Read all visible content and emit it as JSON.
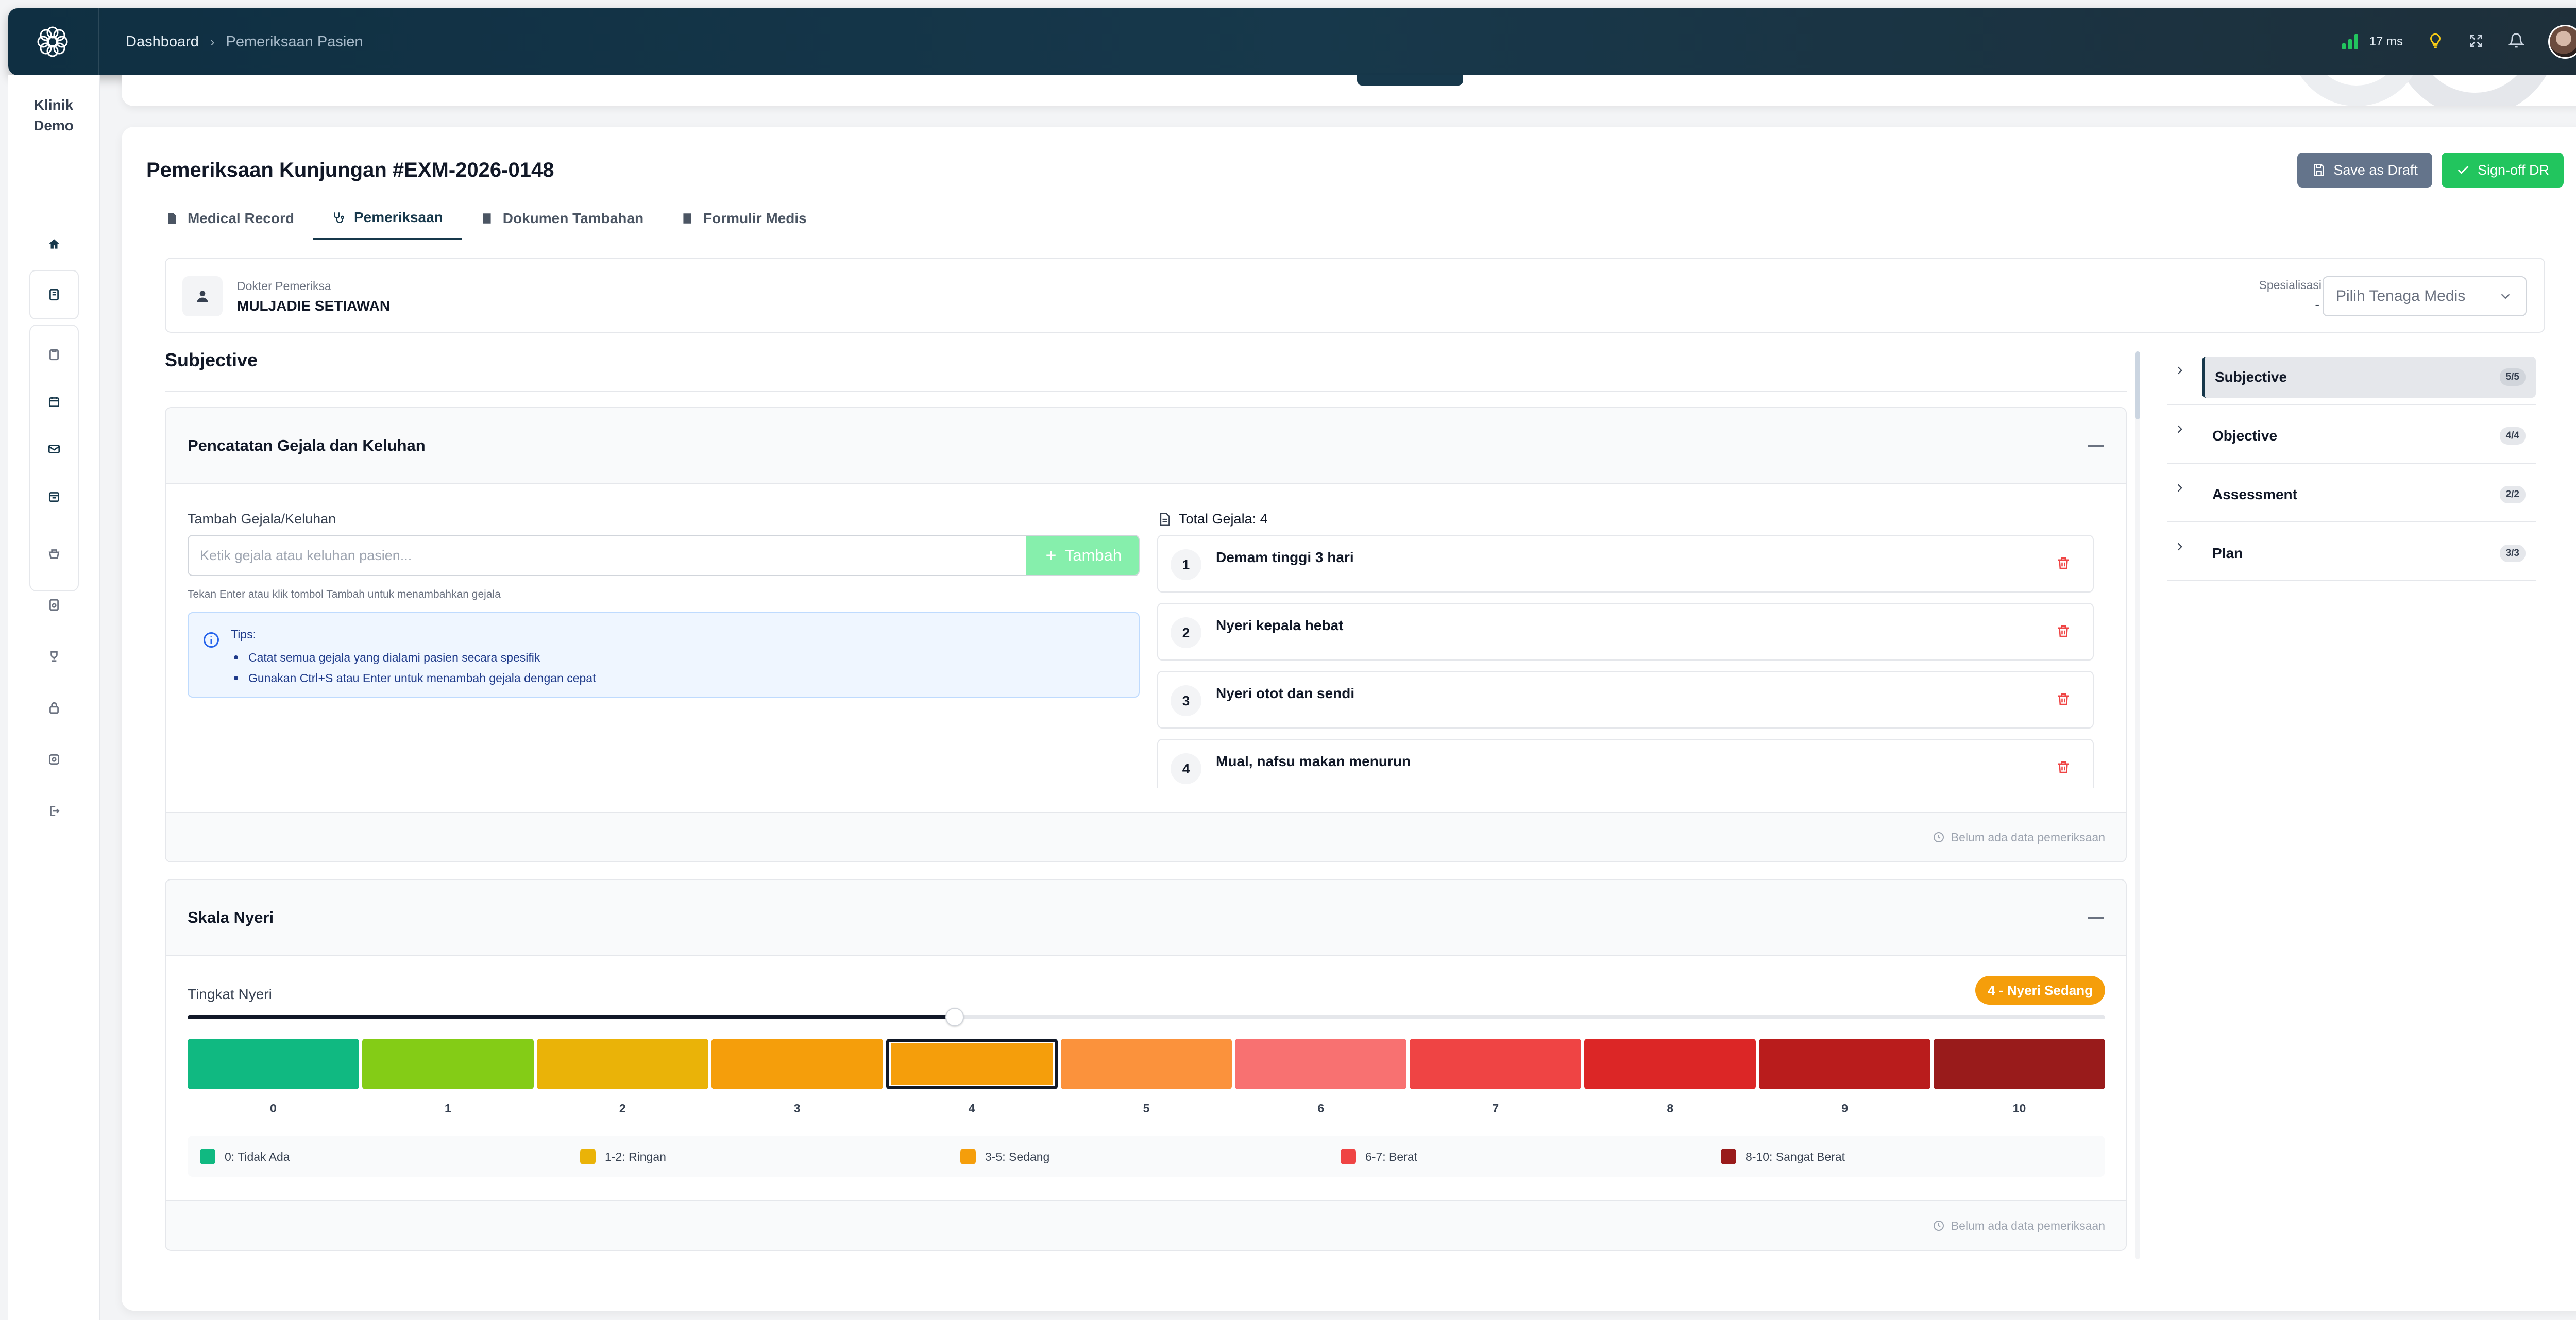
{
  "topbar": {
    "breadcrumb_home": "Dashboard",
    "breadcrumb_sep": "›",
    "breadcrumb_current": "Pemeriksaan Pasien",
    "latency": "17 ms"
  },
  "sidebar": {
    "brand_line1": "Klinik",
    "brand_line2": "Demo"
  },
  "page": {
    "title": "Pemeriksaan Kunjungan #EXM-2026-0148",
    "draft_label": "Save as Draft",
    "signoff_label": "Sign-off DR",
    "tabs": [
      {
        "label": "Medical Record"
      },
      {
        "label": "Pemeriksaan"
      },
      {
        "label": "Dokumen Tambahan"
      },
      {
        "label": "Formulir Medis"
      }
    ]
  },
  "doctor": {
    "caption": "Dokter Pemeriksa",
    "name": "MULJADIE SETIAWAN",
    "spec_label": "Spesialisasi",
    "spec_value": "-",
    "select_placeholder": "Pilih Tenaga Medis"
  },
  "section": {
    "title": "Subjective"
  },
  "symptoms": {
    "panel_title": "Pencatatan Gejala dan Keluhan",
    "add_label": "Tambah Gejala/Keluhan",
    "input_placeholder": "Ketik gejala atau keluhan pasien...",
    "add_button": "Tambah",
    "hint": "Tekan Enter atau klik tombol Tambah untuk menambahkan gejala",
    "tips_title": "Tips:",
    "tips": [
      "Catat semua gejala yang dialami pasien secara spesifik",
      "Gunakan Ctrl+S atau Enter untuk menambah gejala dengan cepat"
    ],
    "total_label": "Total Gejala: 4",
    "items": [
      {
        "num": "1",
        "text": "Demam tinggi 3 hari"
      },
      {
        "num": "2",
        "text": "Nyeri kepala hebat"
      },
      {
        "num": "3",
        "text": "Nyeri otot dan sendi"
      },
      {
        "num": "4",
        "text": "Mual, nafsu makan menurun"
      }
    ],
    "footer": "Belum ada data pemeriksaan"
  },
  "pain": {
    "panel_title": "Skala Nyeri",
    "label": "Tingkat Nyeri",
    "badge": "4 - Nyeri Sedang",
    "value": 4,
    "max": 10,
    "scale": [
      {
        "n": "0",
        "color": "#10b981"
      },
      {
        "n": "1",
        "color": "#84cc16"
      },
      {
        "n": "2",
        "color": "#eab308"
      },
      {
        "n": "3",
        "color": "#f59e0b"
      },
      {
        "n": "4",
        "color": "#f59e0b"
      },
      {
        "n": "5",
        "color": "#fb923c"
      },
      {
        "n": "6",
        "color": "#f87171"
      },
      {
        "n": "7",
        "color": "#ef4444"
      },
      {
        "n": "8",
        "color": "#dc2626"
      },
      {
        "n": "9",
        "color": "#b91c1c"
      },
      {
        "n": "10",
        "color": "#991b1b"
      }
    ],
    "legend": [
      {
        "label": "0: Tidak Ada",
        "color": "#10b981"
      },
      {
        "label": "1-2: Ringan",
        "color": "#eab308"
      },
      {
        "label": "3-5: Sedang",
        "color": "#f59e0b"
      },
      {
        "label": "6-7: Berat",
        "color": "#ef4444"
      },
      {
        "label": "8-10: Sangat Berat",
        "color": "#991b1b"
      }
    ],
    "footer": "Belum ada data pemeriksaan"
  },
  "soap_nav": [
    {
      "label": "Subjective",
      "count": "5/5"
    },
    {
      "label": "Objective",
      "count": "4/4"
    },
    {
      "label": "Assessment",
      "count": "2/2"
    },
    {
      "label": "Plan",
      "count": "3/3"
    }
  ],
  "colors": {
    "primary": "#17384b",
    "success": "#22c55e",
    "draft": "#64748b",
    "badge": "#f59e0b",
    "danger": "#ef4444"
  }
}
